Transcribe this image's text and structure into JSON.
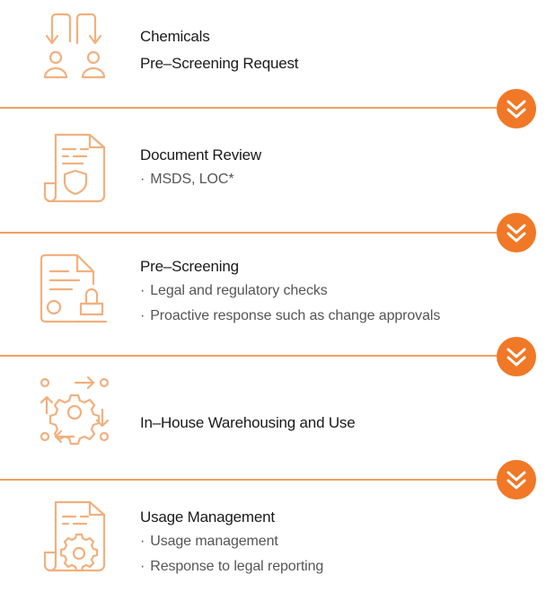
{
  "colors": {
    "accent": "#f07826",
    "icon_stroke": "#f2b07e",
    "divider": "#f0a060"
  },
  "steps": [
    {
      "icon": "transfer-users-icon",
      "title_lines": [
        "Chemicals",
        "Pre–Screening Request"
      ],
      "bullets": []
    },
    {
      "icon": "document-shield-icon",
      "title_lines": [
        "Document Review"
      ],
      "bullets": [
        "MSDS, LOC*"
      ]
    },
    {
      "icon": "document-stamp-icon",
      "title_lines": [
        "Pre–Screening"
      ],
      "bullets": [
        "Legal and regulatory checks",
        "Proactive response such as change approvals"
      ]
    },
    {
      "icon": "gear-cycle-icon",
      "title_lines": [
        "In–House Warehousing and Use"
      ],
      "bullets": []
    },
    {
      "icon": "document-gear-icon",
      "title_lines": [
        "Usage Management"
      ],
      "bullets": [
        "Usage management",
        "Response to legal reporting"
      ]
    }
  ],
  "connector_icon": "double-chevron-down-icon"
}
